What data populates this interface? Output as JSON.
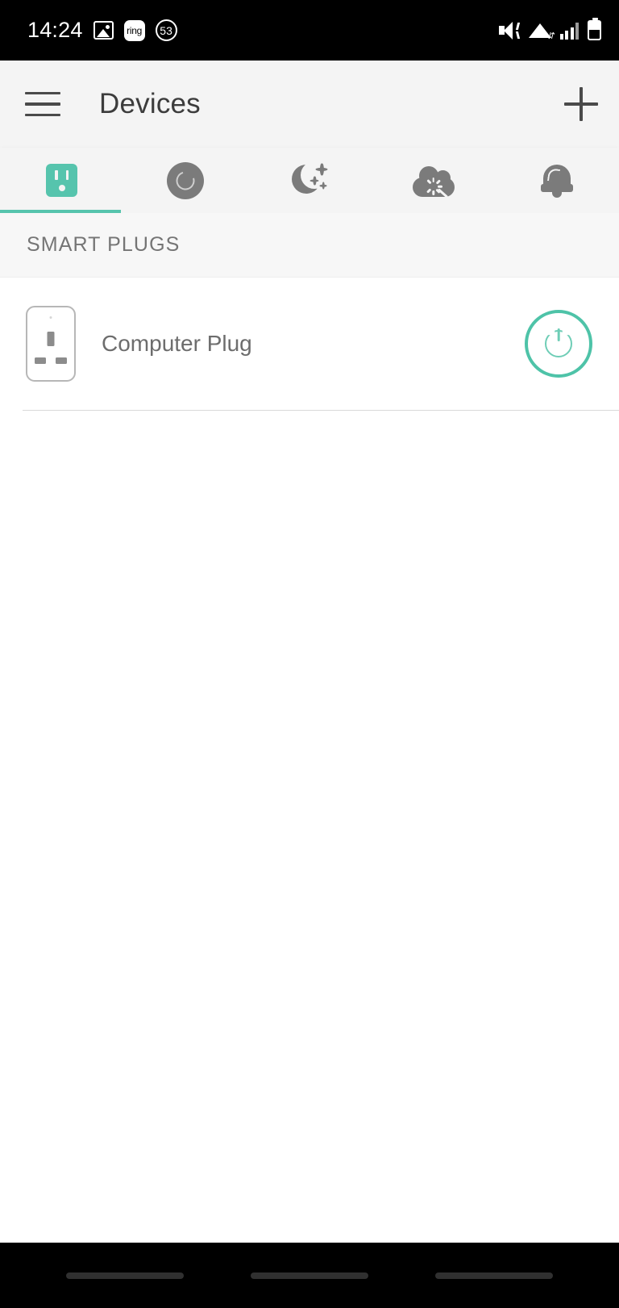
{
  "status_bar": {
    "time": "14:24",
    "left_icons": [
      {
        "name": "gallery-icon",
        "label": ""
      },
      {
        "name": "ring-app-icon",
        "label": "ring"
      },
      {
        "name": "countdown-badge-icon",
        "label": "53"
      }
    ],
    "right_icons": [
      {
        "name": "vibrate-mute-icon"
      },
      {
        "name": "wifi-icon"
      },
      {
        "name": "cellular-signal-icon"
      },
      {
        "name": "battery-icon"
      }
    ]
  },
  "app_bar": {
    "menu_icon": "hamburger-menu-icon",
    "title": "Devices",
    "add_icon": "plus-icon"
  },
  "tabs": {
    "active_index": 0,
    "items": [
      {
        "name": "tab-smart-plugs",
        "icon": "outlet-icon",
        "active": true
      },
      {
        "name": "tab-dimmers",
        "icon": "dimmer-icon",
        "active": false
      },
      {
        "name": "tab-night-mode",
        "icon": "moon-stars-icon",
        "active": false
      },
      {
        "name": "tab-scenes",
        "icon": "cloud-magic-wand-icon",
        "active": false
      },
      {
        "name": "tab-alerts",
        "icon": "bell-icon",
        "active": false
      }
    ]
  },
  "content": {
    "sections": [
      {
        "header": "SMART PLUGS",
        "devices": [
          {
            "name": "Computer Plug",
            "icon": "uk-socket-icon",
            "power_state": "on",
            "power_icon": "power-icon"
          }
        ]
      }
    ]
  },
  "nav_bar": {
    "buttons": [
      {
        "name": "nav-recents-button"
      },
      {
        "name": "nav-home-button"
      },
      {
        "name": "nav-back-button"
      }
    ]
  },
  "colors": {
    "accent": "#4ec3a8",
    "accent_light": "#56c4ad",
    "app_bar_bg": "#f4f4f4",
    "icon_gray": "#7b7b7b",
    "text_gray": "#6d6d6d"
  }
}
